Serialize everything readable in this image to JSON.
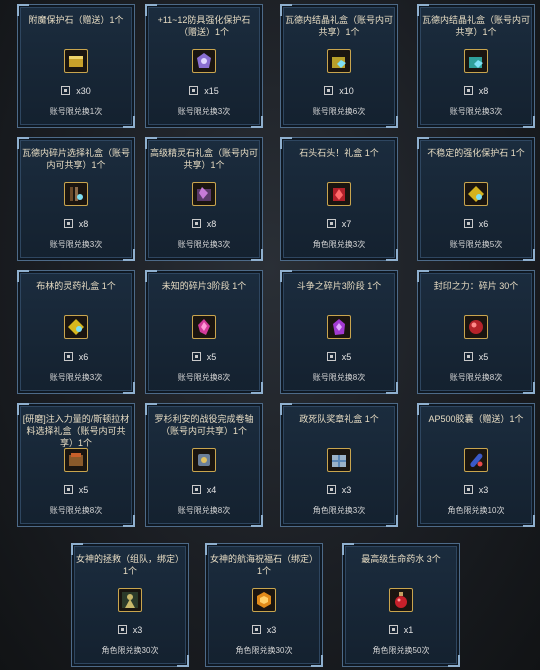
{
  "common": {
    "qty_prefix": "x"
  },
  "items": [
    {
      "title": "附魔保护石（赠送）1个",
      "qty": "x30",
      "limit": "账号限兑换1次",
      "icon": "gold-chest-icon",
      "color": "#c9a12a"
    },
    {
      "title": "+11~12防具强化保护石（赠送）1个",
      "qty": "x15",
      "limit": "账号限兑换3次",
      "icon": "armor-stone-icon",
      "color": "#8a6fd1"
    },
    {
      "title": "瓦德内结晶礼盒（账号内可共享）1个",
      "qty": "x10",
      "limit": "账号限兑换6次",
      "icon": "crystal-box-icon",
      "color": "#b8a02a"
    },
    {
      "title": "瓦德内结晶礼盒（账号内可共享）1个",
      "qty": "x8",
      "limit": "账号限兑换3次",
      "icon": "crystal-box-icon",
      "color": "#2f9f9a"
    },
    {
      "title": "瓦德内碎片选择礼盒（账号内可共享）1个",
      "qty": "x8",
      "limit": "账号限兑换3次",
      "icon": "fragment-box-icon",
      "color": "#6a4a2a"
    },
    {
      "title": "高级精灵石礼盒（账号内可共享）1个",
      "qty": "x8",
      "limit": "账号限兑换3次",
      "icon": "spirit-stone-box-icon",
      "color": "#5a3a6a"
    },
    {
      "title": "石头石头！礼盒 1个",
      "qty": "x7",
      "limit": "角色限兑换3次",
      "icon": "stone-box-icon",
      "color": "#b3202a"
    },
    {
      "title": "不稳定的强化保护石 1个",
      "qty": "x6",
      "limit": "账号限兑换5次",
      "icon": "unstable-stone-icon",
      "color": "#d4b21e"
    },
    {
      "title": "布林的灵药礼盒 1个",
      "qty": "x6",
      "limit": "账号限兑换3次",
      "icon": "elixir-box-icon",
      "color": "#d8b81e"
    },
    {
      "title": "未知的碎片3阶段 1个",
      "qty": "x5",
      "limit": "账号限兑换8次",
      "icon": "pink-shard-icon",
      "color": "#d23a9a"
    },
    {
      "title": "斗争之碎片3阶段 1个",
      "qty": "x5",
      "limit": "账号限兑换8次",
      "icon": "purple-shard-icon",
      "color": "#a23ad2"
    },
    {
      "title": "封印之力：碎片 30个",
      "qty": "x5",
      "limit": "账号限兑换8次",
      "icon": "red-fragment-icon",
      "color": "#b5232a"
    },
    {
      "title": "[研磨]注入力量的/斯顿拉材料选择礼盒（账号内可共享）1个",
      "qty": "x5",
      "limit": "账号限兑换8次",
      "icon": "material-box-icon",
      "color": "#c8602a"
    },
    {
      "title": "罗杉利安的战役完成卷轴（账号内可共享）1个",
      "qty": "x4",
      "limit": "账号限兑换8次",
      "icon": "scroll-icon",
      "color": "#6a7f9a"
    },
    {
      "title": "政死队奖章礼盒 1个",
      "qty": "x3",
      "limit": "角色限兑换3次",
      "icon": "medal-box-icon",
      "color": "#9ab2c8"
    },
    {
      "title": "AP500胶囊（赠送）1个",
      "qty": "x3",
      "limit": "角色限兑换10次",
      "icon": "ap-capsule-icon",
      "color": "#3a5ac8"
    },
    {
      "title": "女神的拯救（组队，绑定）1个",
      "qty": "x3",
      "limit": "角色限兑换30次",
      "icon": "goddess-salvation-icon",
      "color": "#c8b86a"
    },
    {
      "title": "女神的航海祝福石（绑定）1个",
      "qty": "x3",
      "limit": "角色限兑换30次",
      "icon": "voyage-stone-icon",
      "color": "#e08a1a"
    },
    {
      "title": "最高级生命药水 3个",
      "qty": "x1",
      "limit": "角色限兑换50次",
      "icon": "life-potion-icon",
      "color": "#c8202a"
    }
  ]
}
